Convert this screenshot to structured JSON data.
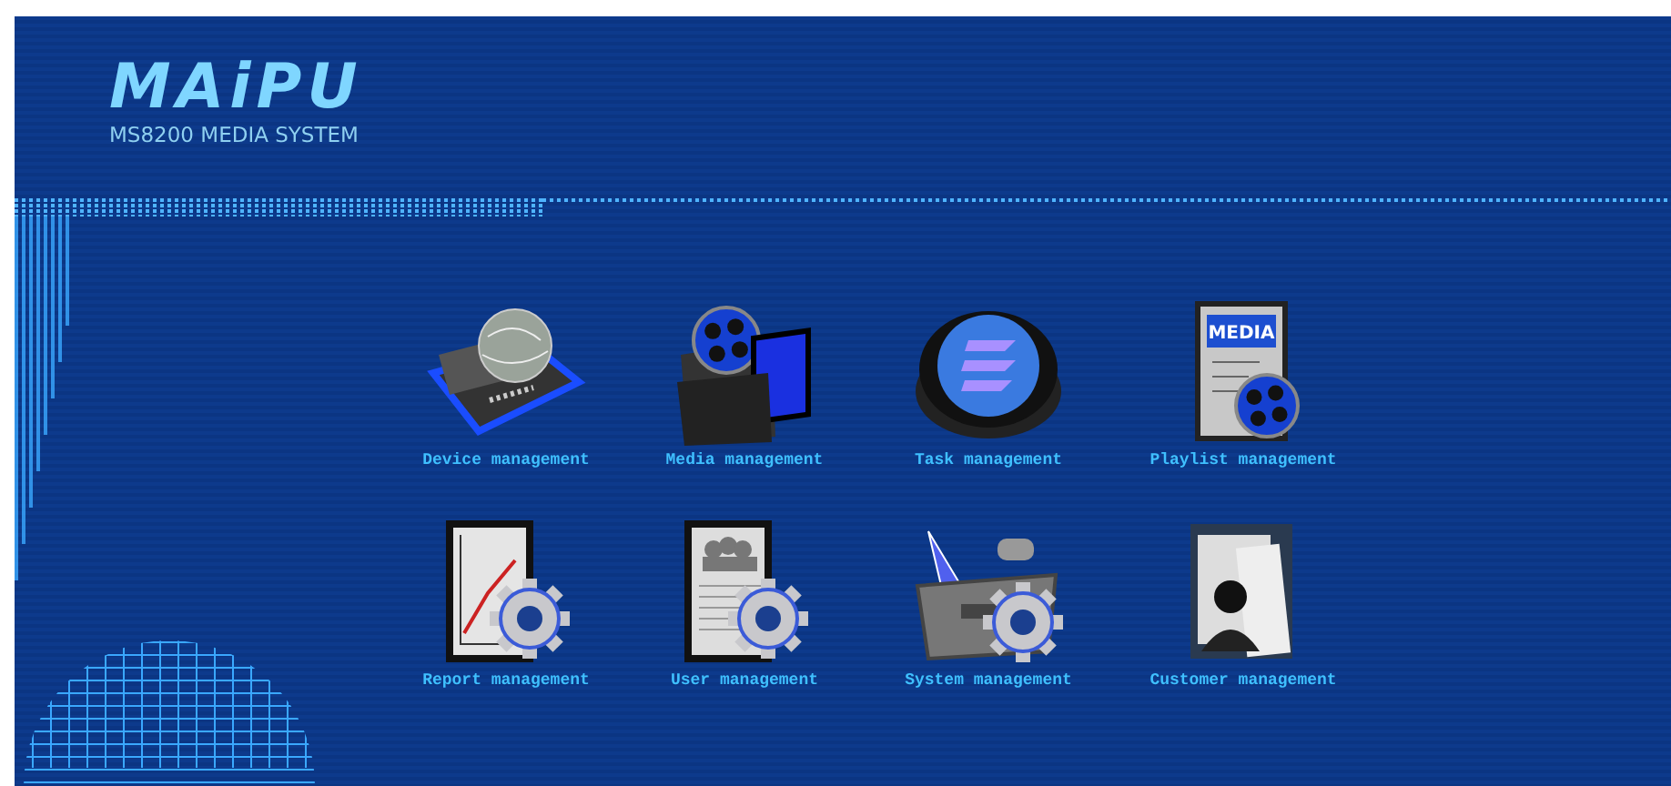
{
  "header": {
    "logo": "MAiPU",
    "subtitle": "MS8200 MEDIA SYSTEM"
  },
  "modules": [
    {
      "kind": "device",
      "label": "Device management"
    },
    {
      "kind": "media",
      "label": "Media management"
    },
    {
      "kind": "task",
      "label": "Task management"
    },
    {
      "kind": "playlist",
      "label": "Playlist management",
      "badge": "MEDIA"
    },
    {
      "kind": "report",
      "label": "Report management"
    },
    {
      "kind": "user",
      "label": "User management"
    },
    {
      "kind": "system",
      "label": "System management"
    },
    {
      "kind": "customer",
      "label": "Customer management"
    }
  ]
}
